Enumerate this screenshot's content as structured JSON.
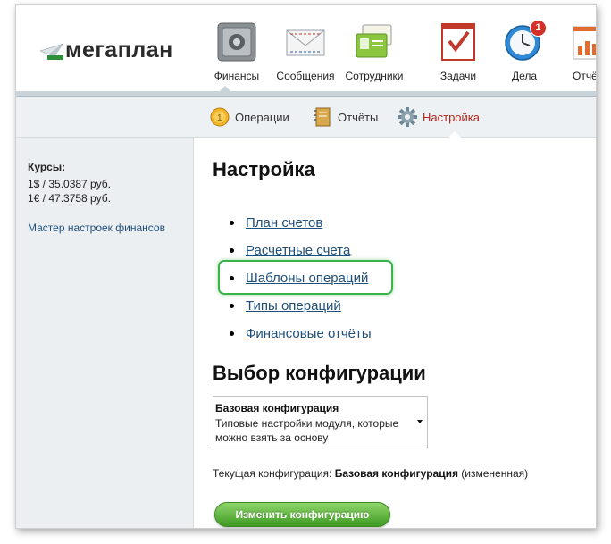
{
  "app": {
    "logo_text": "мегаплан"
  },
  "nav": {
    "items": [
      {
        "label": "Финансы",
        "icon": "safe-icon"
      },
      {
        "label": "Сообщения",
        "icon": "envelope-icon"
      },
      {
        "label": "Сотрудники",
        "icon": "id-cards-icon"
      },
      {
        "label": "Задачи",
        "icon": "checkbox-icon"
      },
      {
        "label": "Дела",
        "icon": "clock-icon",
        "badge": "1"
      },
      {
        "label": "Отчёты",
        "icon": "bar-chart-icon"
      }
    ],
    "active": "Финансы"
  },
  "subnav": {
    "items": [
      {
        "label": "Операции",
        "icon": "coin-icon"
      },
      {
        "label": "Отчёты",
        "icon": "notebook-icon"
      },
      {
        "label": "Настройка",
        "icon": "gear-icon"
      }
    ],
    "active": "Настройка"
  },
  "sidebar": {
    "rates_title": "Курсы:",
    "rates": [
      "1$ / 35.0387 руб.",
      "1€ / 47.3758 руб."
    ],
    "wizard_link": "Мастер настроек финансов"
  },
  "main": {
    "settings_title": "Настройка",
    "links": [
      "План счетов",
      "Расчетные счета",
      "Шаблоны операций",
      "Типы операций",
      "Финансовые отчёты"
    ],
    "highlighted_link": "Шаблоны операций",
    "config_title": "Выбор конфигурации",
    "config_select": {
      "title": "Базовая конфигурация",
      "description": "Типовые настройки модуля, которые можно взять за основу"
    },
    "current_config": {
      "label": "Текущая конфигурация:",
      "value": "Базовая конфигурация",
      "note": "(измененная)"
    },
    "change_button": "Изменить конфигурацию"
  },
  "colors": {
    "link": "#1f4f7a",
    "active_subnav": "#b3261e",
    "highlight": "#39b34a",
    "button": "#3f9a24"
  }
}
